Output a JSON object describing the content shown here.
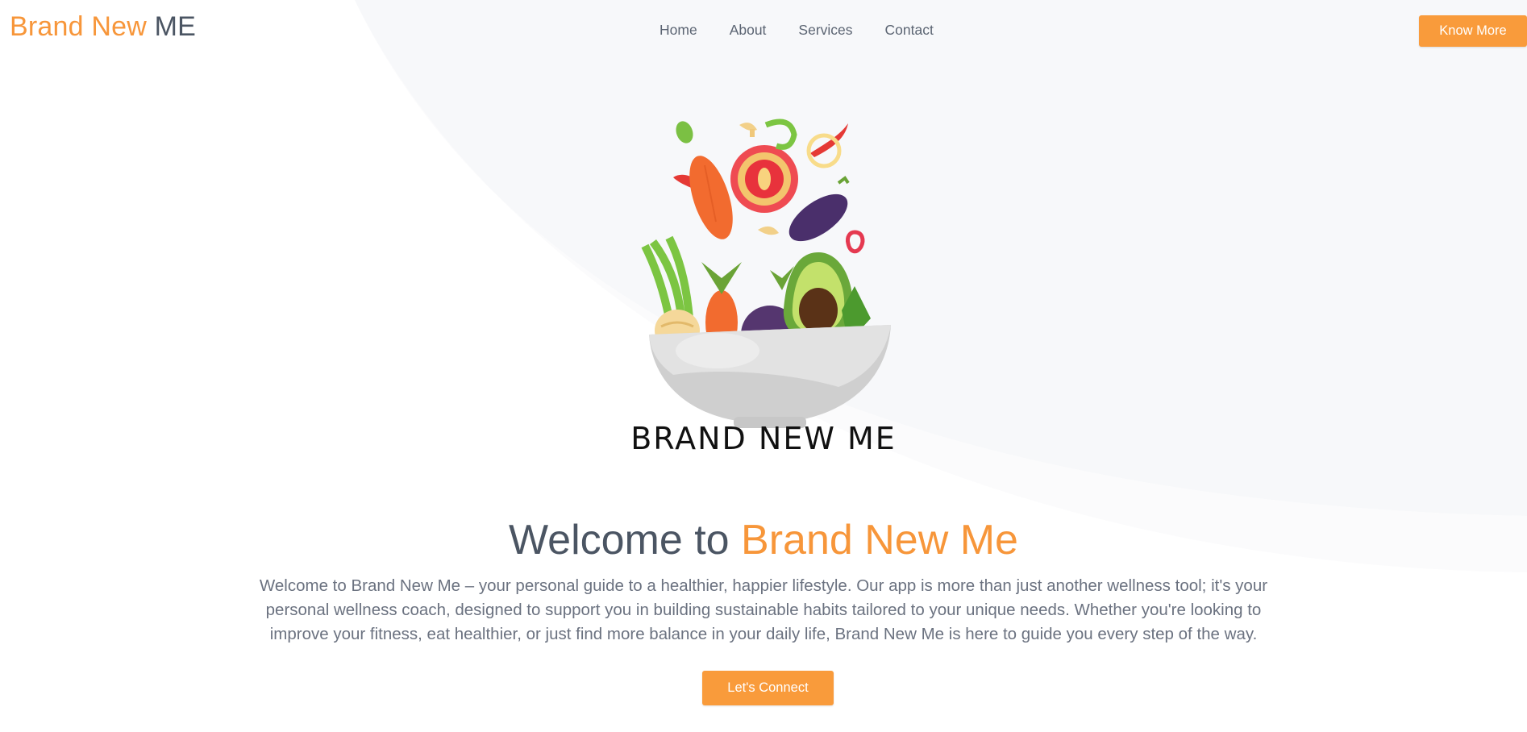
{
  "header": {
    "brand_part1": "Brand New",
    "brand_part2": "ME",
    "nav": [
      "Home",
      "About",
      "Services",
      "Contact"
    ],
    "cta_label": "Know More"
  },
  "hero": {
    "logo_text": "BRAND NEW ME",
    "title_part1": "Welcome to ",
    "title_part2": "Brand New Me",
    "description": "Welcome to Brand New Me – your personal guide to a healthier, happier lifestyle. Our app is more than just another wellness tool; it's your personal wellness coach, designed to support you in building sustainable habits tailored to your unique needs. Whether you're looking to improve your fitness, eat healthier, or just find more balance in your daily life, Brand New Me is here to guide you every step of the way.",
    "cta_label": "Let's Connect"
  },
  "colors": {
    "accent": "#f7963a",
    "text_dark": "#4b5563",
    "text_muted": "#6b7280",
    "background_shape": "#f5f6f8"
  },
  "icons": [
    "vegetable-bowl-illustration"
  ]
}
